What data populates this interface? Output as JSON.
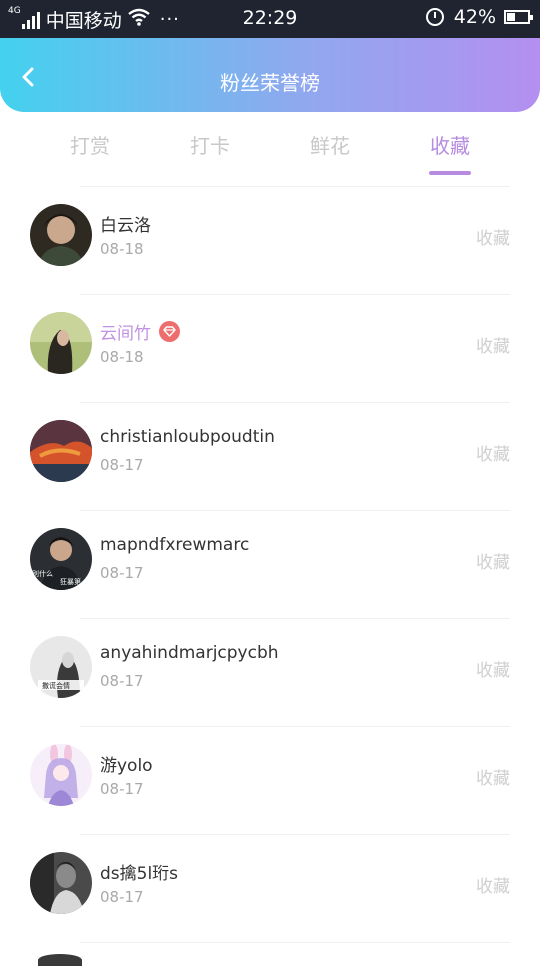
{
  "status_bar": {
    "network": "4G",
    "carrier": "中国移动",
    "dots": "···",
    "time": "22:29",
    "battery": "42%",
    "battery_level": 0.42
  },
  "header": {
    "title": "粉丝荣誉榜"
  },
  "tabs": [
    {
      "label": "打赏",
      "active": false
    },
    {
      "label": "打卡",
      "active": false
    },
    {
      "label": "鲜花",
      "active": false
    },
    {
      "label": "收藏",
      "active": true
    }
  ],
  "colors": {
    "accent": "#b78ce0",
    "header_gradient": [
      "#43d1ee",
      "#b48ff0"
    ],
    "vip_badge": "#ee6d6d"
  },
  "list": [
    {
      "name": "白云洛",
      "date": "08-18",
      "action": "收藏",
      "vip": false
    },
    {
      "name": "云间竹",
      "date": "08-18",
      "action": "收藏",
      "vip": true
    },
    {
      "name": "christianloubpoudtin",
      "date": "08-17",
      "action": "收藏",
      "vip": false
    },
    {
      "name": "mapndfxrewmarc",
      "date": "08-17",
      "action": "收藏",
      "vip": false
    },
    {
      "name": "anyahindmarjcpycbh",
      "date": "08-17",
      "action": "收藏",
      "vip": false
    },
    {
      "name": "游yolo",
      "date": "08-17",
      "action": "收藏",
      "vip": false
    },
    {
      "name": "ds擒5l珩s",
      "date": "08-17",
      "action": "收藏",
      "vip": false
    }
  ],
  "avatar_texts": {
    "a4_line1": "别什么",
    "a4_line2": "狂暴第",
    "a5_caption": "撒谎会情"
  }
}
